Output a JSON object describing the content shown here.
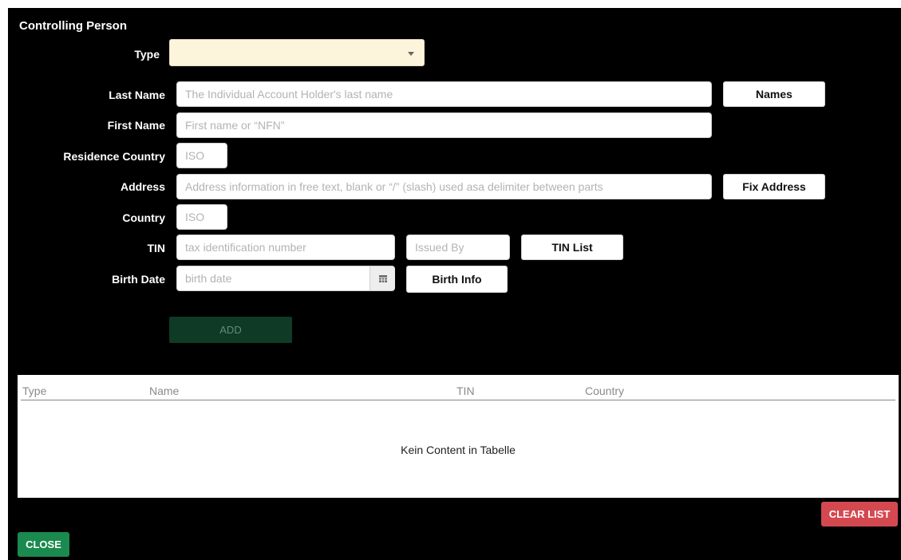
{
  "title": "Controlling Person",
  "labels": {
    "type": "Type",
    "last_name": "Last Name",
    "first_name": "First Name",
    "residence_country": "Residence Country",
    "address": "Address",
    "country": "Country",
    "tin": "TIN",
    "birth_date": "Birth Date"
  },
  "fields": {
    "type_value": "",
    "last_name_placeholder": "The Individual Account Holder's last name",
    "first_name_placeholder": "First name or “NFN”",
    "residence_country_placeholder": "ISO",
    "address_placeholder": "Address information in free text, blank or “/” (slash) used asa delimiter between parts",
    "country_placeholder": "ISO",
    "tin_placeholder": "tax identification number",
    "issued_by_placeholder": "Issued By",
    "birth_date_placeholder": "birth date"
  },
  "buttons": {
    "names": "Names",
    "fix_address": "Fix Address",
    "tin_list": "TIN List",
    "birth_info": "Birth Info",
    "add": "ADD",
    "clear_list": "CLEAR LIST",
    "close": "CLOSE"
  },
  "table": {
    "columns": [
      "Type",
      "Name",
      "TIN",
      "Country"
    ],
    "empty_message": "Kein Content in Tabelle"
  },
  "icons": {
    "type_dropdown": "chevron-down-icon",
    "birth_date_picker": "calendar-icon"
  },
  "colors": {
    "background": "#000000",
    "select_bg": "#fdf4dc",
    "add_button": "#0f3a26",
    "clear_button": "#d44950",
    "close_button": "#1a8a4e"
  }
}
